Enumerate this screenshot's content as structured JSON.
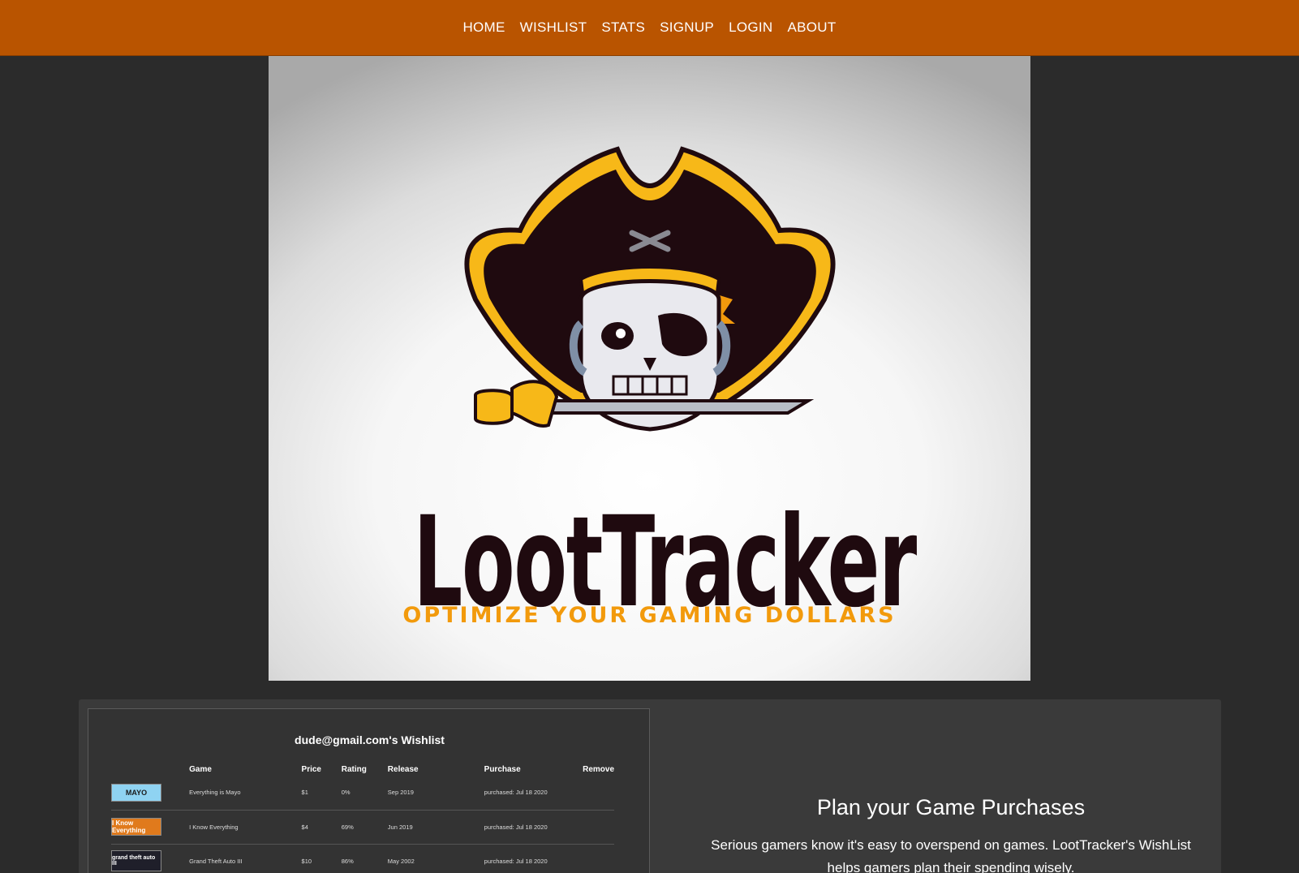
{
  "nav": {
    "items": [
      {
        "label": "HOME"
      },
      {
        "label": "WISHLIST"
      },
      {
        "label": "STATS"
      },
      {
        "label": "SIGNUP"
      },
      {
        "label": "LOGIN"
      },
      {
        "label": "ABOUT"
      }
    ]
  },
  "hero": {
    "logo_name": "LootTracker",
    "tagline": "OPTIMIZE YOUR GAMING DOLLARS",
    "icon": "pirate-skull-icon",
    "colors": {
      "hat": "#1f0a0f",
      "gold": "#f7b818",
      "orange": "#f29a0c",
      "accent": "#b95400"
    }
  },
  "feature": {
    "screenshot": {
      "title": "dude@gmail.com's Wishlist",
      "columns": [
        "Game",
        "Price",
        "Rating",
        "Release",
        "Purchase",
        "Remove"
      ],
      "rows": [
        {
          "thumb": "MAYO",
          "game": "Everything is Mayo",
          "price": "$1",
          "rating": "0%",
          "release": "Sep 2019",
          "purchase": "purchased: Jul 18 2020"
        },
        {
          "thumb": "I Know Everything",
          "game": "I Know Everything",
          "price": "$4",
          "rating": "69%",
          "release": "Jun 2019",
          "purchase": "purchased: Jul 18 2020"
        },
        {
          "thumb": "grand theft auto III",
          "game": "Grand Theft Auto III",
          "price": "$10",
          "rating": "86%",
          "release": "May 2002",
          "purchase": "purchased: Jul 18 2020"
        }
      ]
    },
    "heading": "Plan your Game Purchases",
    "body": "Serious gamers know it's easy to overspend on games. LootTracker's WishList helps gamers plan their spending wisely."
  }
}
